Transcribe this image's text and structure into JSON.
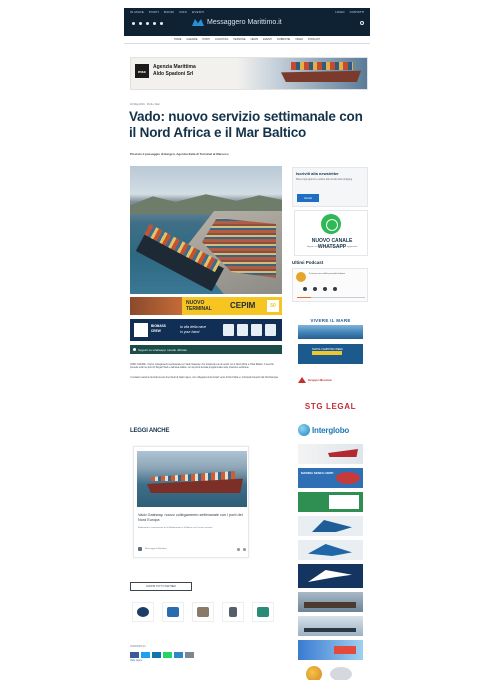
{
  "header": {
    "top_links": [
      "IN MARE",
      "PORTI",
      "BANDI",
      "INFO",
      "EVENTI"
    ],
    "right_links": [
      "LOGIN",
      "CONTATTI"
    ],
    "brand": "Messaggero Marittimo.it",
    "nav": [
      "HOME",
      "AGENZIE",
      "PORTI",
      "LOGISTICA",
      "PERSONE",
      "NEWS",
      "EVENTI",
      "RUBRICHE",
      "VIDEO",
      "PODCAST"
    ]
  },
  "ad_top": {
    "line1": "Agenzia Marittima",
    "line2": "Aldo Spadoni Srl",
    "logo": "msc"
  },
  "article": {
    "meta": "16 Mag 2019 · Porti e Navi",
    "title": "Vado: nuovo servizio settimanale con il Nord Africa e il Mar Baltico",
    "subtitle": "Previsto il passaggio di Bergen, Agenzia Italia di Terminal al Marocco"
  },
  "ads_mid": {
    "terminal_line1": "NUOVO",
    "terminal_line2": "TERMINAL",
    "terminal_brand": "CEPIM",
    "terminal_badge": "50",
    "bio_brand_1": "BIOMASS",
    "bio_brand_2": "CREW",
    "bio_slogan_1": "la vita della nave",
    "bio_slogan_2": "in your hand",
    "follow": "Seguici su whatsapp: canale ufficiale"
  },
  "body": {
    "p1": "VADO LIGURE - Nuovo collegamento settimanale per Vado Gateway, che amplia la rete di servizi con il Nord Africa e il Mar Baltico. Il servizio prevede scali nei porti di Tangeri Med e dell'area baltica, con la prima toccata programmata nelle prossime settimane.",
    "p2": "I container saranno lavorati presso il terminal di Vado Ligure, con collegamenti ferroviari verso il Nord Italia e i principali interporti del Nord Europa."
  },
  "leggi_anche": "LEGGI ANCHE",
  "related": {
    "title": "Vado Gateway, nuovo collegamento settimanale con i porti del Nord Europa",
    "excerpt": "Rafforzata la connessione tra il Mediterraneo e il Baltico con il nuovo servizio",
    "author": "Messaggero Marittimo"
  },
  "partners_button": "SCOPRI TUTTI I PARTNER",
  "share_label": "CONDIVIDI SU",
  "share_colors": [
    "#3b5998",
    "#1da1f2",
    "#0e76a8",
    "#25d366",
    "#2d88c7",
    "#7a8690"
  ],
  "tag": "Vado Ligure",
  "sidebar": {
    "newsletter_title": "Iscriviti alla newsletter",
    "newsletter_desc": "Ricevi ogni giorno le notizie dal mondo dello shipping",
    "newsletter_button": "Iscriviti",
    "whatsapp_title": "NUOVO CANALE WHATSAPP",
    "whatsapp_desc": "Seguici su Whatsapp per essere sempre aggiornato",
    "podcast_title": "Ultimi Podcast",
    "podcast_text": "Il nuovo corso della portualità italiana",
    "ad_vivere": "VIVERE IL MARE",
    "ad_napoli": "NAPOLI SHIPPING WEEK",
    "ad_gruppo": "Gruppo Messina",
    "ad_stg": "STG LEGAL",
    "ad_inter": "Interglobo",
    "ad_sa2": "MARINA SENZA LIMITI"
  },
  "colors": {
    "navy": "#0f2233",
    "brand_blue": "#2a8fd6",
    "headline": "#14324a",
    "whatsapp_green": "#2fb955",
    "stg_red": "#c62c36",
    "interglobo": "#1e79b6",
    "cepim_yellow": "#f6c521"
  }
}
